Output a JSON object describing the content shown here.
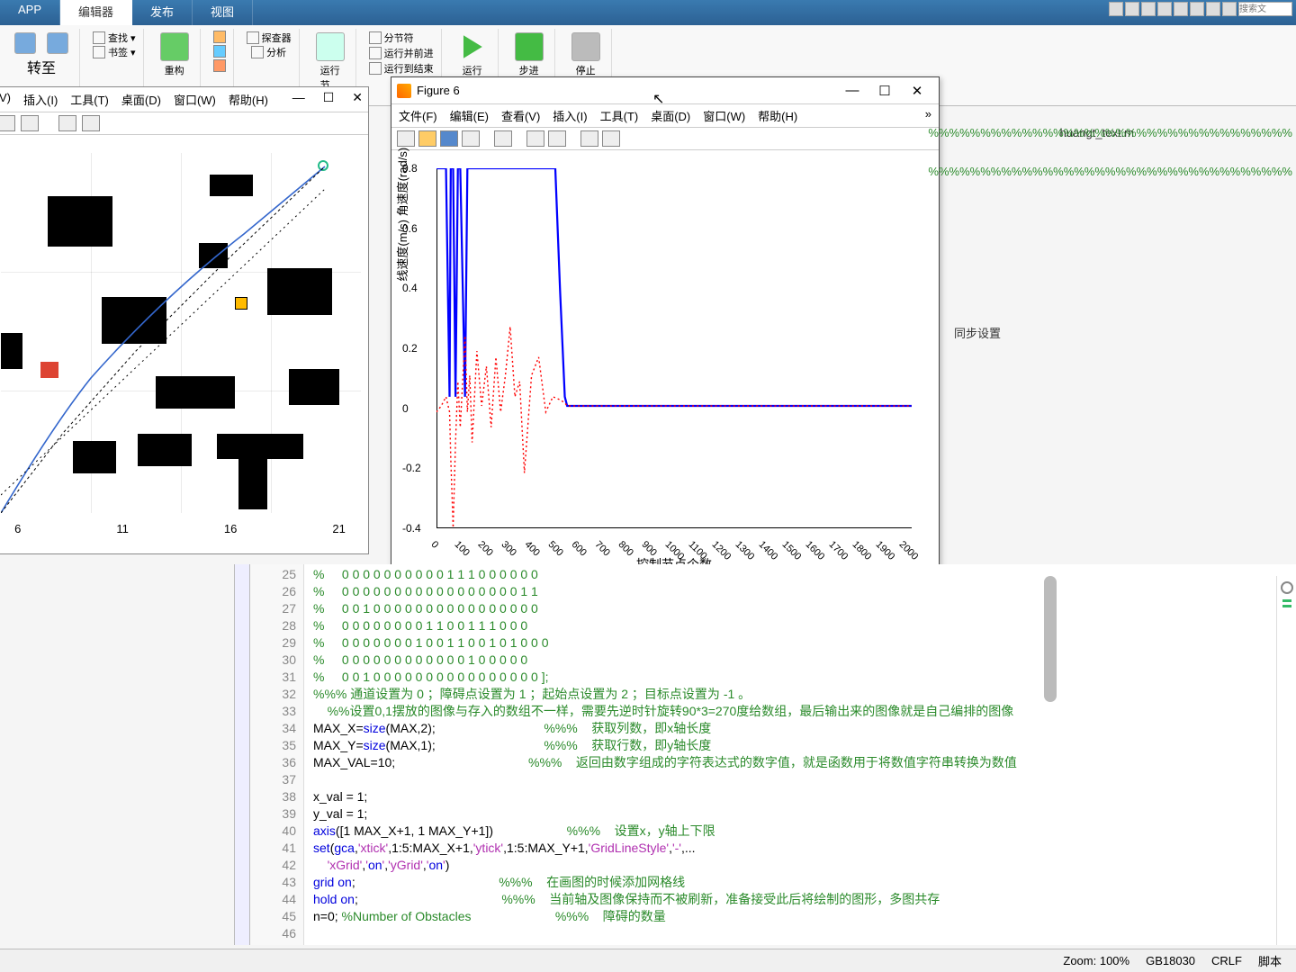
{
  "ribbon": {
    "tabs": [
      "APP",
      "编辑器",
      "发布",
      "视图"
    ],
    "active_tab": 1,
    "btn_goto": "转至",
    "btn_find": "查找 ▾",
    "btn_bookmark": "书签 ▾",
    "btn_refactor": "重构",
    "btn_explorer": "探查器",
    "btn_analyze": "分析",
    "btn_runsection": "运行\n节",
    "btn_sectionbreak": "分节符",
    "btn_runadvance": "运行并前进",
    "btn_runtoend": "运行到结束",
    "btn_run": "运行",
    "btn_step": "步进",
    "btn_stop": "停止",
    "search_placeholder": "搜索文"
  },
  "leftwin": {
    "menus": [
      "V)",
      "插入(I)",
      "工具(T)",
      "桌面(D)",
      "窗口(W)",
      "帮助(H)"
    ],
    "xticks": [
      "6",
      "11",
      "16",
      "21"
    ]
  },
  "figwin": {
    "title": "Figure 6",
    "menus": [
      "文件(F)",
      "编辑(E)",
      "查看(V)",
      "插入(I)",
      "工具(T)",
      "桌面(D)",
      "窗口(W)",
      "帮助(H)"
    ]
  },
  "chart_data": {
    "type": "line",
    "title": "",
    "xlabel": "控制节点个数",
    "ylabel": "线速度(m/s) 角速度(rad/s)",
    "xlim": [
      0,
      2000
    ],
    "ylim": [
      -0.4,
      0.8
    ],
    "xticks": [
      0,
      100,
      200,
      300,
      400,
      500,
      600,
      700,
      800,
      900,
      1000,
      1100,
      1200,
      1300,
      1400,
      1500,
      1600,
      1700,
      1800,
      1900,
      2000
    ],
    "yticks": [
      -0.4,
      -0.2,
      0,
      0.2,
      0.4,
      0.6,
      0.8
    ],
    "series": [
      {
        "name": "linear_velocity",
        "color": "#0000ff",
        "style": "solid",
        "x": [
          0,
          20,
          40,
          55,
          60,
          70,
          80,
          90,
          100,
          120,
          130,
          140,
          150,
          160,
          170,
          180,
          190,
          200,
          250,
          300,
          350,
          400,
          420,
          440,
          460,
          480,
          500,
          520,
          540,
          550,
          560,
          600,
          2000
        ],
        "y": [
          0.8,
          0.8,
          0.8,
          0.05,
          0.8,
          0.8,
          0.05,
          0.8,
          0.8,
          0.05,
          0.8,
          0.8,
          0.8,
          0.8,
          0.8,
          0.8,
          0.8,
          0.8,
          0.8,
          0.8,
          0.8,
          0.8,
          0.8,
          0.8,
          0.8,
          0.8,
          0.8,
          0.4,
          0.05,
          0.02,
          0.02,
          0.02,
          0.02
        ]
      },
      {
        "name": "angular_velocity",
        "color": "#ff0000",
        "style": "dotted",
        "x": [
          0,
          20,
          40,
          55,
          60,
          70,
          80,
          90,
          100,
          120,
          130,
          140,
          150,
          170,
          190,
          210,
          230,
          250,
          270,
          290,
          310,
          330,
          350,
          370,
          400,
          430,
          460,
          490,
          520,
          540,
          550,
          560,
          600,
          2000
        ],
        "y": [
          0.0,
          0.02,
          0.05,
          0.0,
          -0.15,
          -0.38,
          -0.1,
          0.1,
          -0.05,
          0.25,
          0.0,
          0.12,
          -0.1,
          0.2,
          0.02,
          0.15,
          -0.05,
          0.18,
          0.0,
          0.12,
          0.28,
          0.05,
          0.1,
          -0.2,
          0.12,
          0.18,
          0.0,
          0.05,
          0.04,
          0.03,
          0.02,
          0.02,
          0.02,
          0.02
        ]
      }
    ]
  },
  "editor": {
    "first_line": 25,
    "lines": [
      "%     0 0 0 0 0 0 0 0 0 0 1 1 1 0 0 0 0 0 0",
      "%     0 0 0 0 0 0 0 0 0 0 0 0 0 0 0 0 0 1 1",
      "%     0 0 1 0 0 0 0 0 0 0 0 0 0 0 0 0 0 0 0",
      "%     0 0 0 0 0 0 0 0 1 1 0 0 1 1 1 0 0 0",
      "%     0 0 0 0 0 0 0 1 0 0 1 1 0 0 1 0 1 0 0 0",
      "%     0 0 0 0 0 0 0 0 0 0 0 0 1 0 0 0 0 0",
      "%     0 0 1 0 0 0 0 0 0 0 0 0 0 0 0 0 0 0 0 ];",
      "%%% 通道设置为 0 ；障碍点设置为 1 ；起始点设置为 2 ；目标点设置为 -1 。",
      "    %%设置0,1摆放的图像与存入的数组不一样，需要先逆时针旋转90*3=270度给数组，最后输出来的图像就是自己编排的图像",
      "MAX_X=size(MAX,2);                               %%%    获取列数，即x轴长度",
      "MAX_Y=size(MAX,1);                               %%%    获取行数，即y轴长度",
      "MAX_VAL=10;                                      %%%    返回由数字组成的字符表达式的数字值，就是函数用于将数值字符串转换为数值",
      "",
      "x_val = 1;",
      "y_val = 1;",
      "axis([1 MAX_X+1, 1 MAX_Y+1])                     %%%    设置x，y轴上下限",
      "set(gca,'xtick',1:5:MAX_X+1,'ytick',1:5:MAX_Y+1,'GridLineStyle','-',...",
      "    'xGrid','on','yGrid','on')",
      "grid on;                                         %%%    在画图的时候添加网格线",
      "hold on;                                         %%%    当前轴及图像保持而不被刷新，准备接受此后将绘制的图形，多图共存",
      "n=0; %Number of Obstacles                        %%%    障碍的数量",
      ""
    ]
  },
  "file_tab": "huangt_text.m",
  "side_text": "同步设置",
  "right_comments": [
    "%%%%%%%%%%%%%%%%%%%%%%%%%%%%%%%%%%%",
    "%%%%%%%%%%%%%%%%%%%%%%%%%%%%%%%%%%%"
  ],
  "status": {
    "zoom": "Zoom: 100%",
    "encoding": "GB18030",
    "eol": "CRLF",
    "type": "脚本"
  }
}
